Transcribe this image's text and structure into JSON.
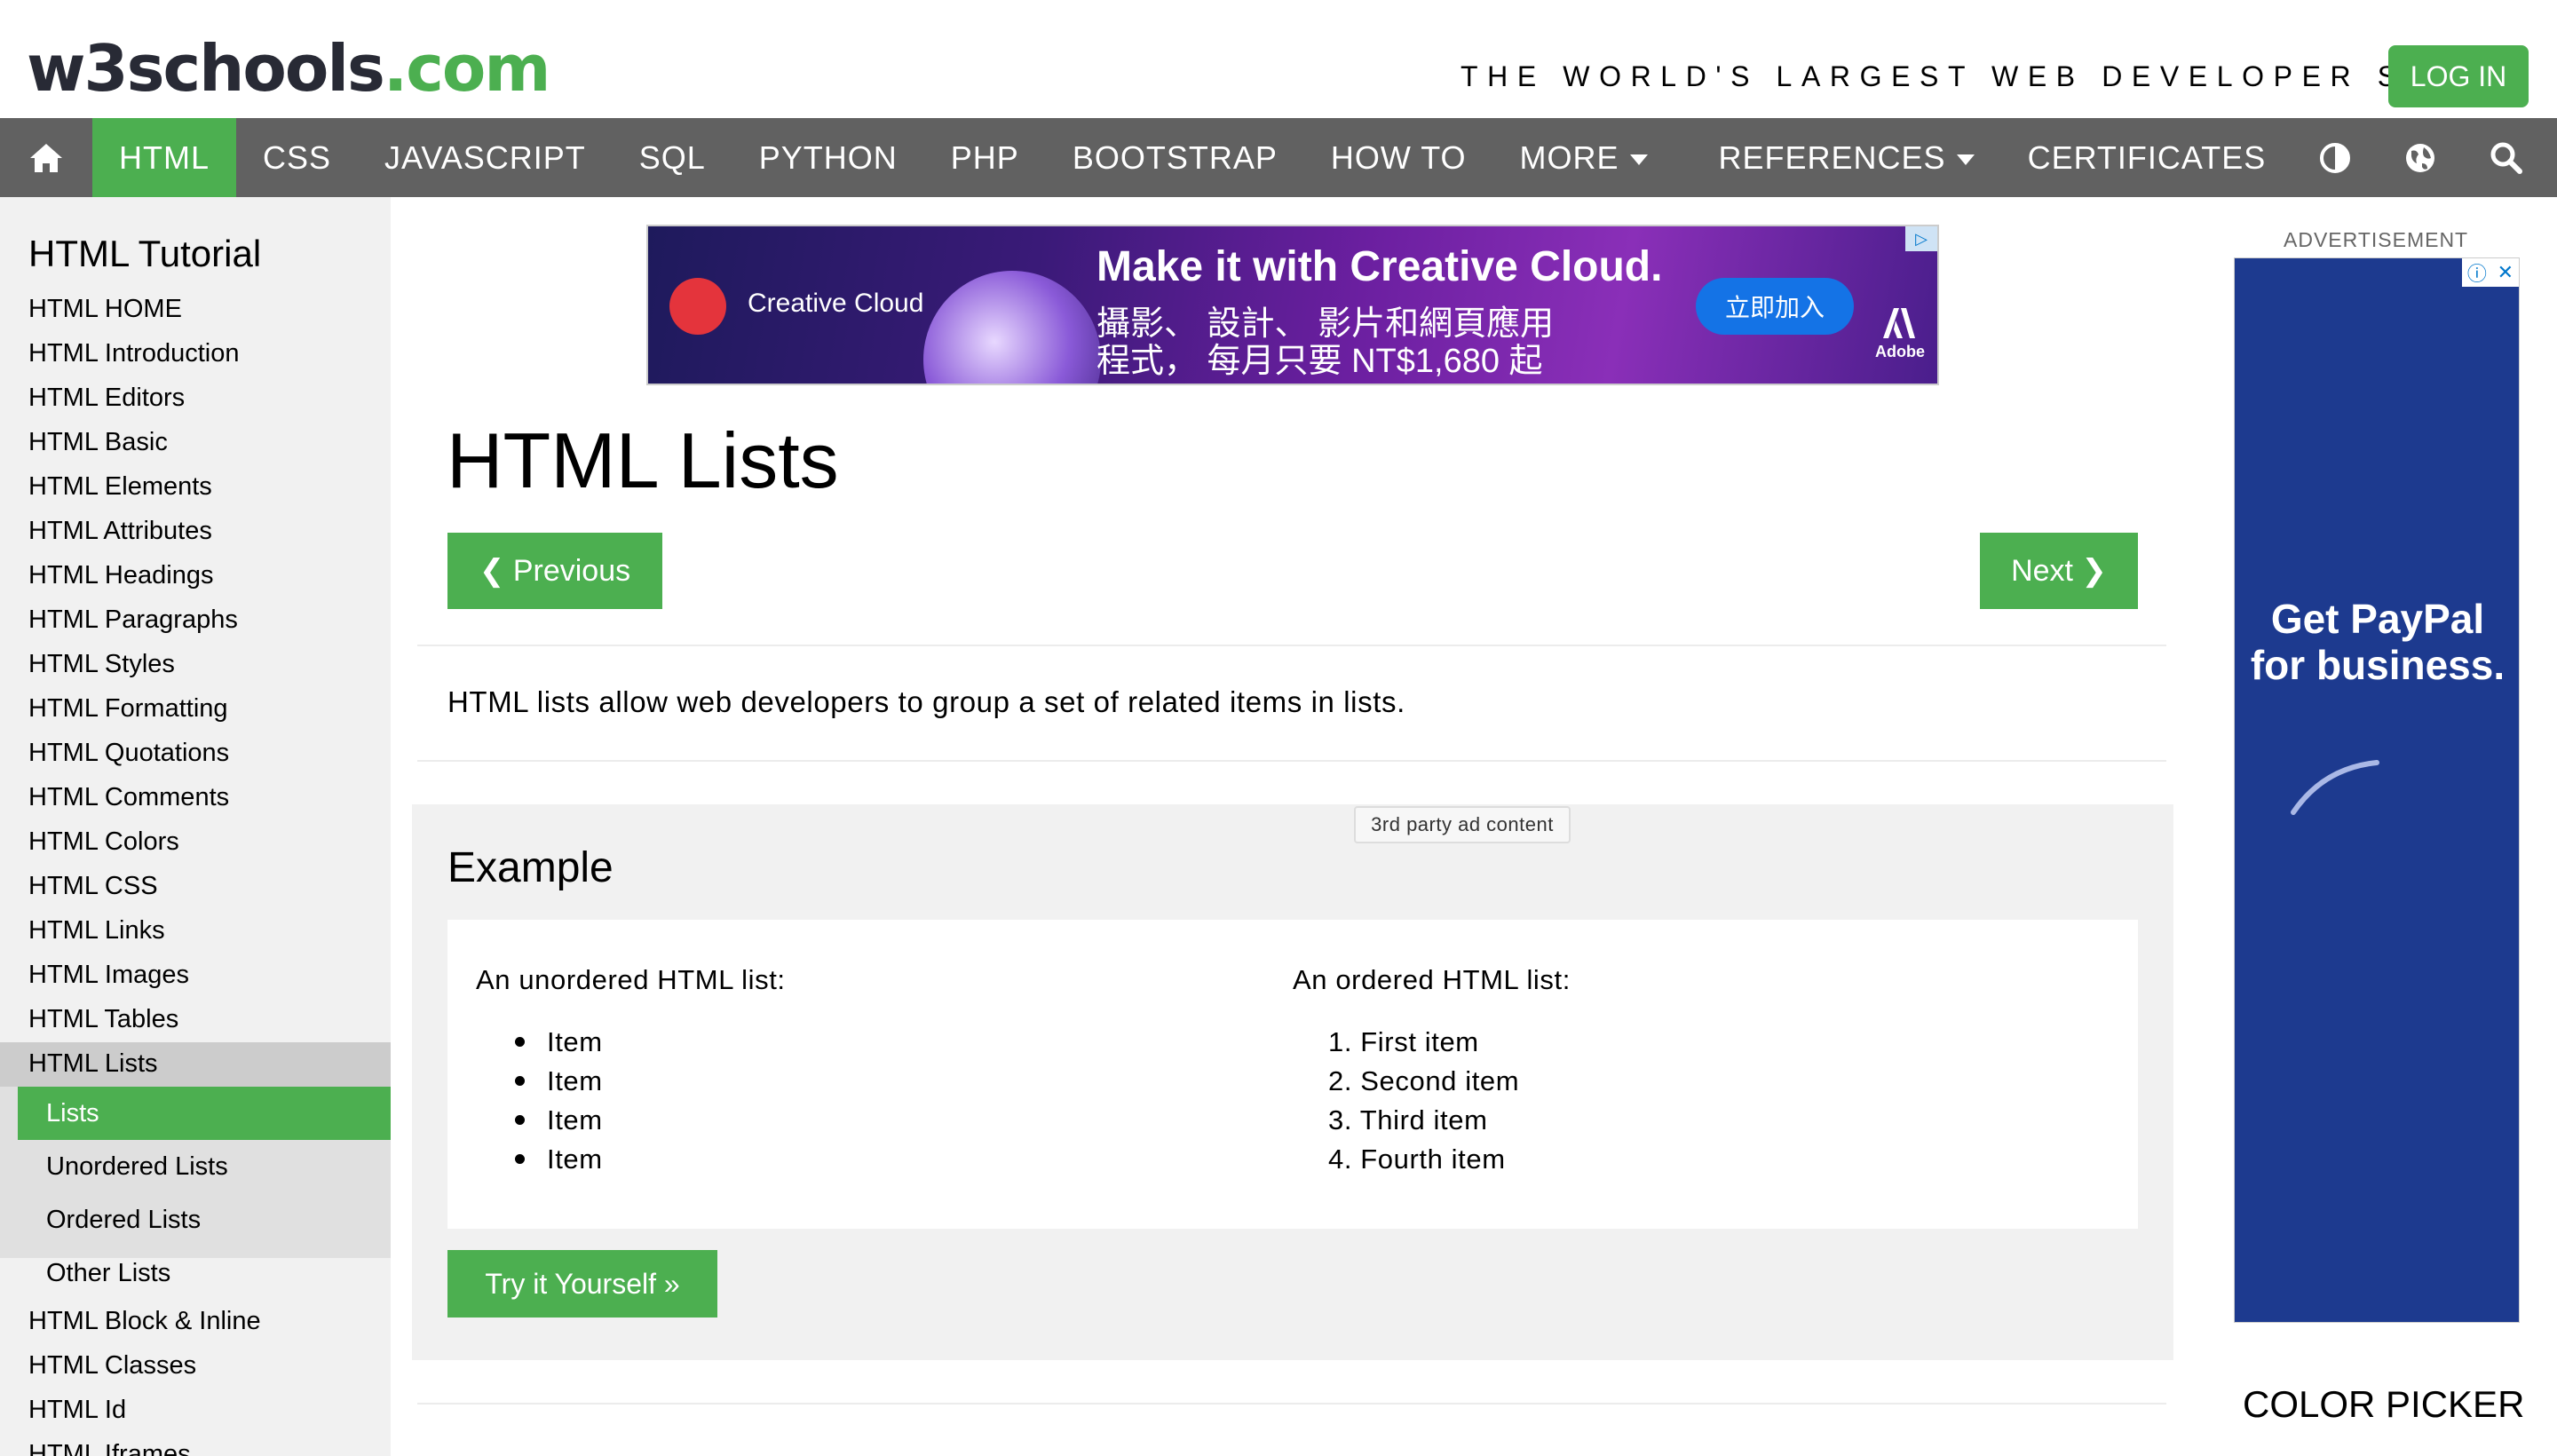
{
  "header": {
    "logo_main": "w3schools",
    "logo_dot": ".com",
    "tagline": "THE WORLD'S LARGEST WEB DEVELOPER SITE",
    "login_label": "LOG IN"
  },
  "topnav": {
    "items": [
      "HTML",
      "CSS",
      "JAVASCRIPT",
      "SQL",
      "PYTHON",
      "PHP",
      "BOOTSTRAP",
      "HOW TO",
      "MORE",
      "REFERENCES",
      "CERTIFICATES"
    ],
    "active": "HTML"
  },
  "sidebar": {
    "title": "HTML Tutorial",
    "items": [
      "HTML HOME",
      "HTML Introduction",
      "HTML Editors",
      "HTML Basic",
      "HTML Elements",
      "HTML Attributes",
      "HTML Headings",
      "HTML Paragraphs",
      "HTML Styles",
      "HTML Formatting",
      "HTML Quotations",
      "HTML Comments",
      "HTML Colors",
      "HTML CSS",
      "HTML Links",
      "HTML Images",
      "HTML Tables",
      "HTML Lists"
    ],
    "sub_items": [
      "Lists",
      "Unordered Lists",
      "Ordered Lists",
      "Other Lists"
    ],
    "after_items": [
      "HTML Block & Inline",
      "HTML Classes",
      "HTML Id",
      "HTML Iframes"
    ]
  },
  "banner": {
    "brand": "Creative Cloud",
    "headline": "Make it with Creative Cloud.",
    "line1": "攝影、 設計、 影片和網頁應用",
    "line2": "程式， 每月只要 NT$1,680 起",
    "join_label": "立即加入",
    "adobe": "Adobe"
  },
  "main": {
    "title": "HTML Lists",
    "prev_label": "❮ Previous",
    "next_label": "Next ❯",
    "intro": "HTML lists allow web developers to group a set of related items in lists.",
    "ad_note": "3rd party ad content",
    "example": {
      "title": "Example",
      "unordered_heading": "An unordered HTML list:",
      "unordered_items": [
        "Item",
        "Item",
        "Item",
        "Item"
      ],
      "ordered_heading": "An ordered HTML list:",
      "ordered_items": [
        "1. First item",
        "2. Second item",
        "3. Third item",
        "4. Fourth item"
      ],
      "try_label": "Try it Yourself »"
    }
  },
  "right": {
    "advertisement_label": "ADVERTISEMENT",
    "ad_line1": "Get PayPal",
    "ad_line2": "for business.",
    "color_picker": "COLOR PICKER"
  },
  "colors": {
    "accent": "#4caf50",
    "nav_bg": "#616161",
    "sidebar_bg": "#f1f1f1"
  }
}
